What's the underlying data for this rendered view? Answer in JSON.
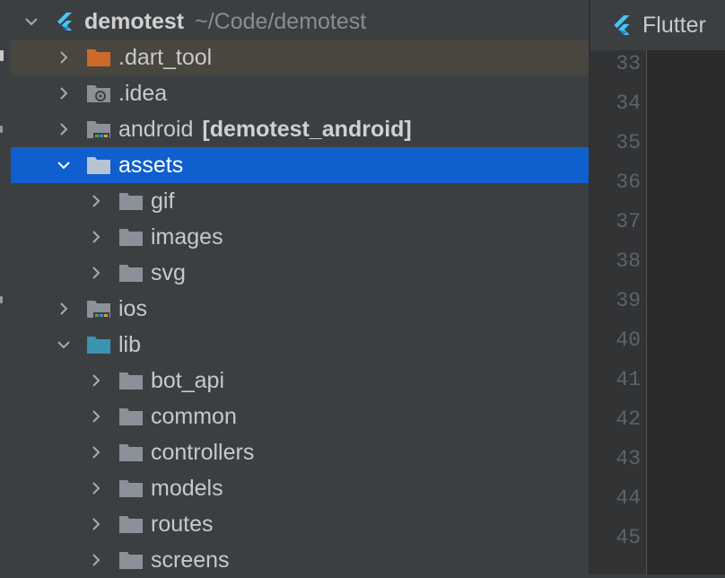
{
  "project": {
    "name": "demotest",
    "path": "~/Code/demotest"
  },
  "tree": [
    {
      "label": ".dart_tool",
      "expanded": false,
      "icon": "folder-orange-icon"
    },
    {
      "label": ".idea",
      "expanded": false,
      "icon": "folder-settings-icon"
    },
    {
      "label": "android",
      "module": "[demotest_android]",
      "expanded": false,
      "icon": "folder-module-icon"
    },
    {
      "label": "assets",
      "expanded": true,
      "selected": true,
      "icon": "folder-icon"
    },
    {
      "label": "gif",
      "expanded": false,
      "icon": "folder-icon"
    },
    {
      "label": "images",
      "expanded": false,
      "icon": "folder-icon"
    },
    {
      "label": "svg",
      "expanded": false,
      "icon": "folder-icon"
    },
    {
      "label": "ios",
      "expanded": false,
      "icon": "folder-module-icon"
    },
    {
      "label": "lib",
      "expanded": true,
      "icon": "folder-source-icon"
    },
    {
      "label": "bot_api",
      "expanded": false,
      "icon": "folder-icon"
    },
    {
      "label": "common",
      "expanded": false,
      "icon": "folder-icon"
    },
    {
      "label": "controllers",
      "expanded": false,
      "icon": "folder-icon"
    },
    {
      "label": "models",
      "expanded": false,
      "icon": "folder-icon"
    },
    {
      "label": "routes",
      "expanded": false,
      "icon": "folder-icon"
    },
    {
      "label": "screens",
      "expanded": false,
      "icon": "folder-icon"
    }
  ],
  "editor": {
    "tab_label": "Flutter",
    "line_numbers": [
      "33",
      "34",
      "35",
      "36",
      "37",
      "38",
      "39",
      "40",
      "41",
      "42",
      "43",
      "44",
      "45"
    ]
  },
  "colors": {
    "selection": "#0f5fce",
    "hover": "#48463e",
    "flutter_blue": "#47c5fb"
  }
}
